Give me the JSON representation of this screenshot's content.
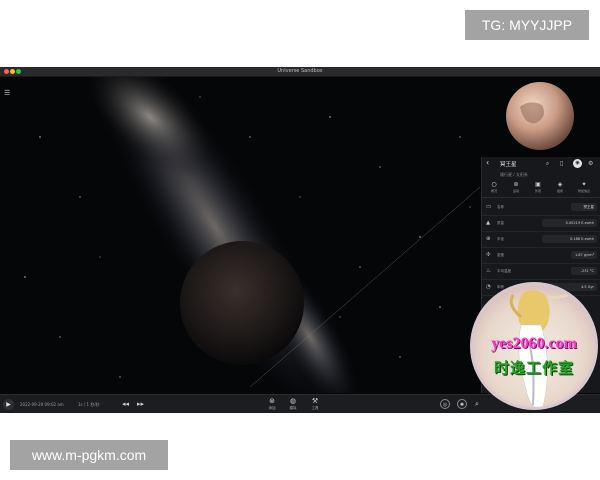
{
  "overlays": {
    "top_tag": "TG: MYYJJPP",
    "bottom_tag": "www.m-pgkm.com"
  },
  "window": {
    "title": "Universe Sandbox"
  },
  "panel": {
    "object_name": "冥王星",
    "subtitle": "矮行星 / 太阳系",
    "tabs": [
      {
        "label": "概况",
        "icon": "circle-icon"
      },
      {
        "label": "运动",
        "icon": "orbit-icon"
      },
      {
        "label": "外观",
        "icon": "image-icon"
      },
      {
        "label": "组成",
        "icon": "layers-icon"
      },
      {
        "label": "附加信息",
        "icon": "info-icon"
      }
    ],
    "properties": [
      {
        "label": "名称",
        "value": "冥王星",
        "icon": "tag-icon"
      },
      {
        "label": "质量",
        "value": "0.00219 E-earth",
        "icon": "weight-icon"
      },
      {
        "label": "半径",
        "value": "0.186 E-earth",
        "icon": "radius-icon"
      },
      {
        "label": "密度",
        "value": "1.87 g/cm³",
        "icon": "density-icon"
      },
      {
        "label": "平均温度",
        "value": "-231 °C",
        "icon": "temperature-icon"
      },
      {
        "label": "年龄",
        "value": "4.5 Gyr",
        "icon": "age-icon"
      }
    ]
  },
  "bottombar": {
    "date": "2022-09-29 09:02 am",
    "rate": "1s / 1 秒/秒",
    "tools": [
      {
        "label": "添加",
        "icon": "add-icon"
      },
      {
        "label": "模拟",
        "icon": "sim-icon"
      },
      {
        "label": "工具",
        "icon": "wrench-icon"
      }
    ]
  },
  "watermark": {
    "line1": "yes2060.com",
    "line2": "时逸工作室"
  },
  "colors": {
    "panel_bg": "#17181b",
    "window_bg": "#050608",
    "watermark_pink": "#ff3ccf",
    "watermark_green": "#2ca02c"
  }
}
